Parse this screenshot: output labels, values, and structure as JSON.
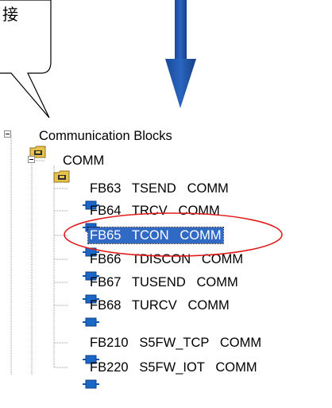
{
  "callout": {
    "text": "接"
  },
  "tree": {
    "root": {
      "label": "Communication Blocks"
    },
    "folder": {
      "label": "COMM"
    },
    "items": [
      {
        "label": "FB63   TSEND   COMM"
      },
      {
        "label": "FB64   TRCV   COMM"
      },
      {
        "label": "FB65   TCON   COMM",
        "selected": true
      },
      {
        "label": "FB66   TDISCON   COMM"
      },
      {
        "label": "FB67   TUSEND   COMM"
      },
      {
        "label": "FB68   TURCV   COMM"
      },
      {
        "label": "FB210   S5FW_TCP   COMM"
      },
      {
        "label": "FB220   S5FW_IOT   COMM"
      }
    ]
  },
  "colors": {
    "arrow": "#1f4fa0",
    "highlight_ellipse": "#e01c1c",
    "selection": "#316ac5"
  }
}
